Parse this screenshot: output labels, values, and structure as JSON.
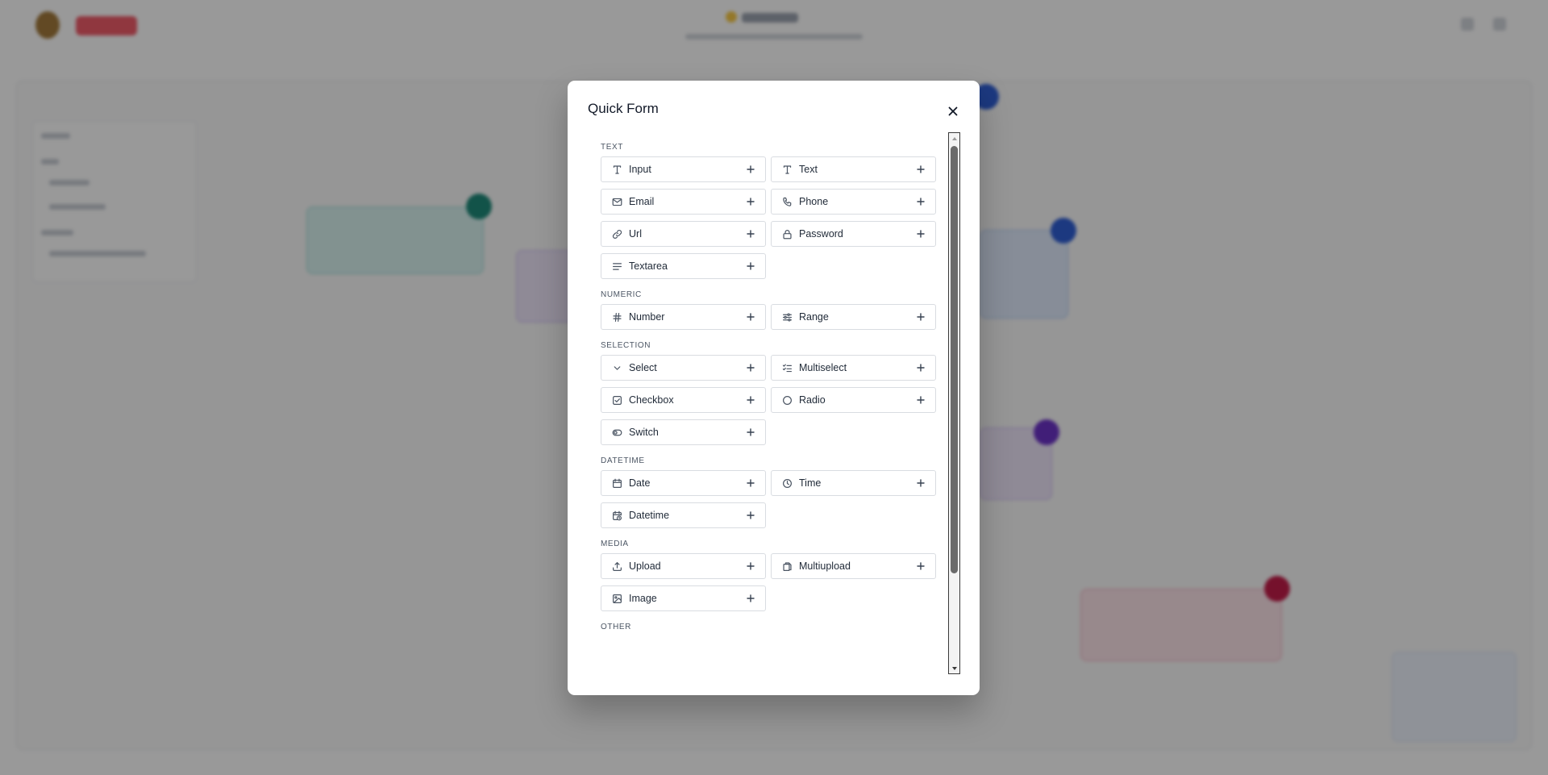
{
  "modal": {
    "title": "Quick Form",
    "close_icon": "close-icon",
    "sections": [
      {
        "label": "TEXT",
        "fields": [
          {
            "label": "Input",
            "icon": "type-icon"
          },
          {
            "label": "Text",
            "icon": "type-icon"
          },
          {
            "label": "Email",
            "icon": "mail-icon"
          },
          {
            "label": "Phone",
            "icon": "phone-icon"
          },
          {
            "label": "Url",
            "icon": "link-icon"
          },
          {
            "label": "Password",
            "icon": "lock-icon"
          },
          {
            "label": "Textarea",
            "icon": "align-left-icon"
          }
        ]
      },
      {
        "label": "NUMERIC",
        "fields": [
          {
            "label": "Number",
            "icon": "hash-icon"
          },
          {
            "label": "Range",
            "icon": "sliders-icon"
          }
        ]
      },
      {
        "label": "SELECTION",
        "fields": [
          {
            "label": "Select",
            "icon": "chevron-down-icon"
          },
          {
            "label": "Multiselect",
            "icon": "list-checks-icon"
          },
          {
            "label": "Checkbox",
            "icon": "checkbox-icon"
          },
          {
            "label": "Radio",
            "icon": "circle-icon"
          },
          {
            "label": "Switch",
            "icon": "toggle-icon"
          }
        ]
      },
      {
        "label": "DATETIME",
        "fields": [
          {
            "label": "Date",
            "icon": "calendar-icon"
          },
          {
            "label": "Time",
            "icon": "clock-icon"
          },
          {
            "label": "Datetime",
            "icon": "calendar-clock-icon"
          }
        ]
      },
      {
        "label": "MEDIA",
        "fields": [
          {
            "label": "Upload",
            "icon": "upload-icon"
          },
          {
            "label": "Multiupload",
            "icon": "files-icon"
          },
          {
            "label": "Image",
            "icon": "image-icon"
          }
        ]
      },
      {
        "label": "OTHER",
        "fields": []
      }
    ]
  },
  "colors": {
    "overlay": "rgba(0,0,0,0.40)",
    "button_border": "#d9dce1",
    "text": "#1f2937",
    "section_label": "#4b5563"
  }
}
